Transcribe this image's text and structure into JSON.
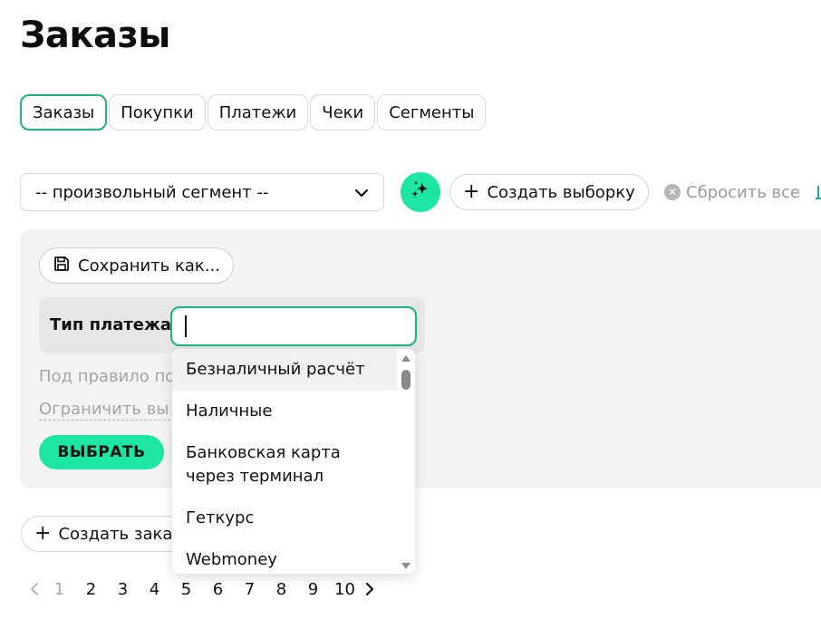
{
  "page": {
    "title": "Заказы"
  },
  "tabs": [
    {
      "label": "Заказы",
      "active": true
    },
    {
      "label": "Покупки",
      "active": false
    },
    {
      "label": "Платежи",
      "active": false
    },
    {
      "label": "Чеки",
      "active": false
    },
    {
      "label": "Сегменты",
      "active": false
    }
  ],
  "toolbar": {
    "segment_select_value": "-- произвольный сегмент --",
    "ai_icon": "sparkles-icon",
    "create_selection_label": "Создать выборку",
    "reset_all_label": "Сбросить все"
  },
  "filter": {
    "save_as_label": "Сохранить как...",
    "rule_label": "Тип платежа",
    "rule_input_value": "",
    "sub_rule_label": "Под правило по",
    "limit_label": "Ограничить вы",
    "select_button_label": "ВЫБРАТЬ"
  },
  "dropdown": {
    "options": [
      "Безналичный расчёт",
      "Наличные",
      "Банковская карта через терминал",
      "Геткурс",
      "Webmoney"
    ],
    "highlighted_index": 0
  },
  "create_order_label": "Создать заказ",
  "pagination": {
    "current": "1",
    "pages": [
      "1",
      "2",
      "3",
      "4",
      "5",
      "6",
      "7",
      "8",
      "9",
      "10"
    ]
  },
  "colors": {
    "accent": "#1de5a3",
    "accent_border": "#1bb386",
    "panel_bg": "#f3f3f3",
    "muted_text": "#a4a4a4"
  }
}
